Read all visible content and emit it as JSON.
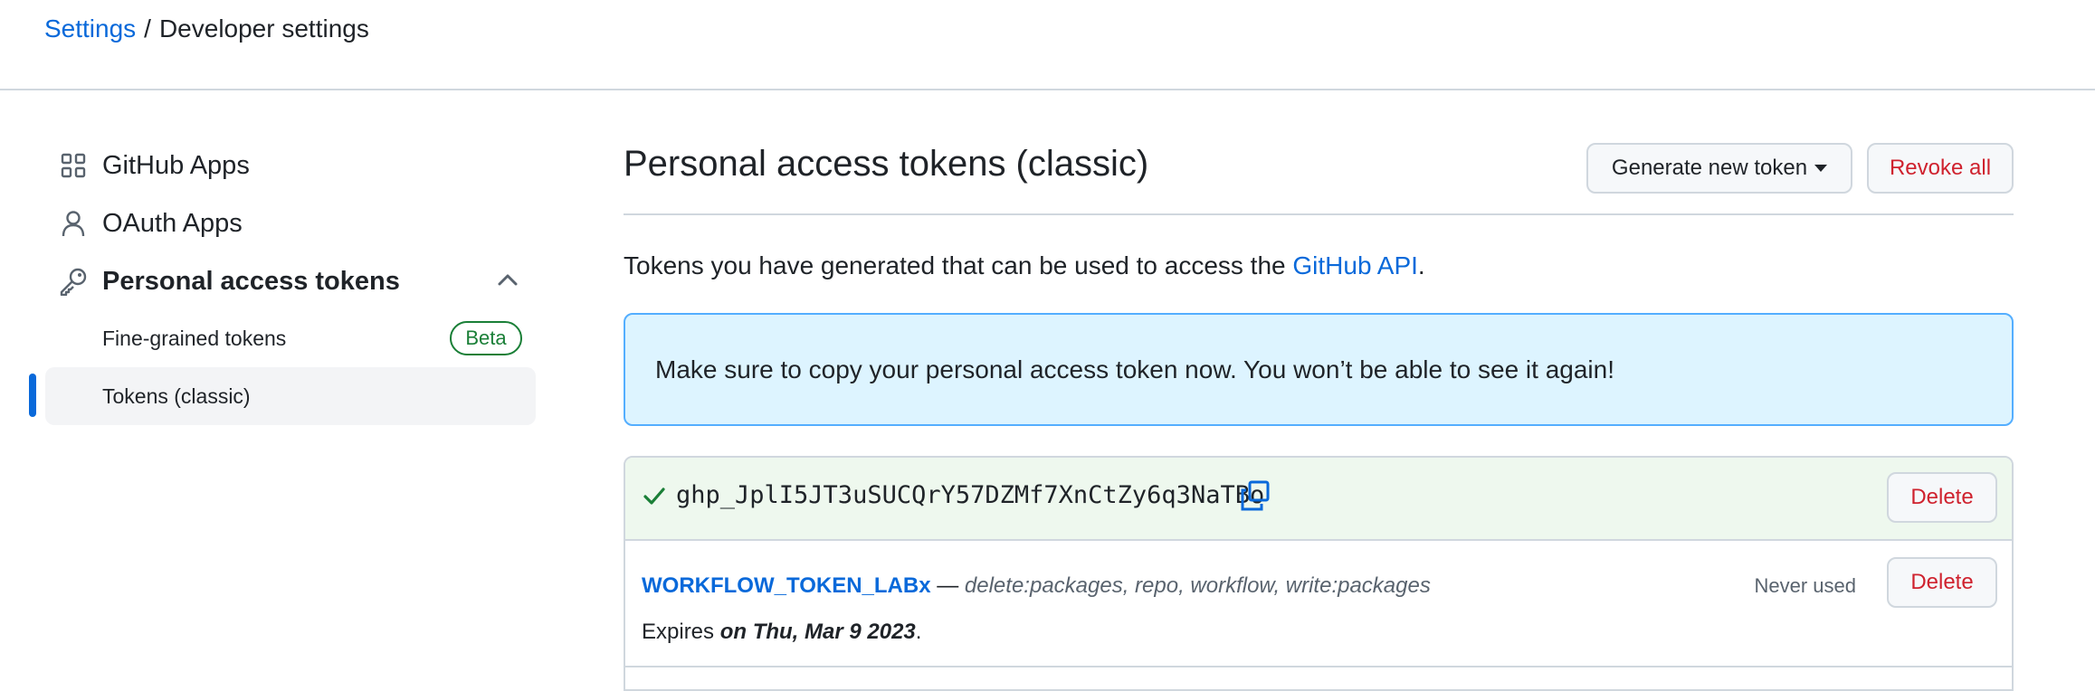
{
  "breadcrumb": {
    "parent": "Settings",
    "separator": "/",
    "current": "Developer settings"
  },
  "sidebar": {
    "items": [
      {
        "label": "GitHub Apps",
        "icon": "apps-grid-icon"
      },
      {
        "label": "OAuth Apps",
        "icon": "person-icon"
      },
      {
        "label": "Personal access tokens",
        "icon": "key-icon",
        "expanded": true
      }
    ],
    "sub_items": [
      {
        "label": "Fine-grained tokens",
        "badge": "Beta"
      },
      {
        "label": "Tokens (classic)",
        "active": true
      }
    ]
  },
  "main": {
    "title": "Personal access tokens (classic)",
    "generate_label": "Generate new token",
    "revoke_label": "Revoke all",
    "intro_text": "Tokens you have generated that can be used to access the",
    "intro_link": "GitHub API",
    "intro_end": ".",
    "flash": "Make sure to copy your personal access token now. You won’t be able to see it again!",
    "new_token": {
      "value": "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",
      "delete_label": "Delete"
    },
    "tokens": [
      {
        "name": "WORKFLOW_TOKEN_LABx",
        "dash": "—",
        "scopes": "delete:packages, repo, workflow, write:packages",
        "usage": "Never used",
        "expires_prefix": "Expires",
        "expires_date": "on Thu, Mar 9 2023",
        "expires_suffix": ".",
        "delete_label": "Delete"
      }
    ]
  },
  "colors": {
    "link": "#0969da",
    "danger": "#cf222e",
    "success": "#1a7f37",
    "flash_bg": "#ddf4ff",
    "new_token_bg": "#eef8ee"
  }
}
